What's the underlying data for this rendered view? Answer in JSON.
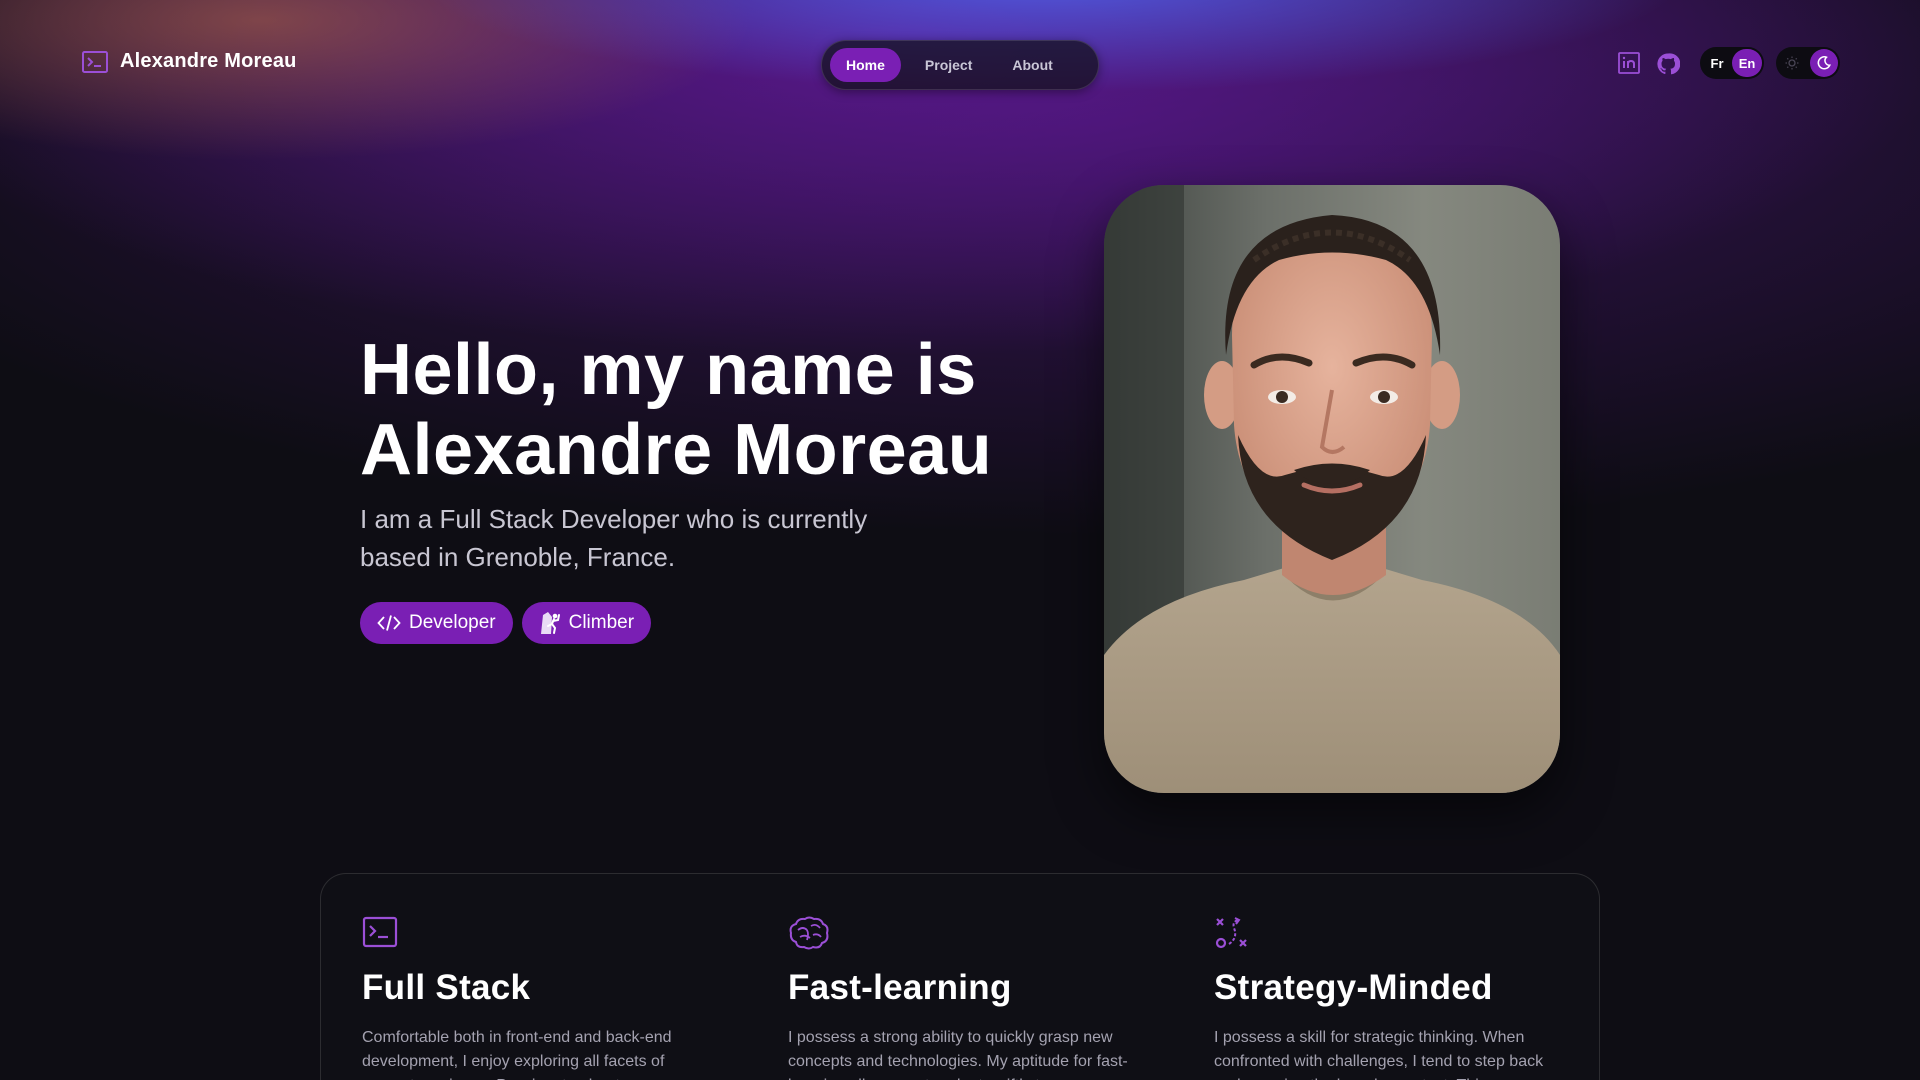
{
  "brand": {
    "name": "Alexandre Moreau",
    "icon": "terminal-icon"
  },
  "nav": {
    "items": [
      {
        "label": "Home",
        "active": true
      },
      {
        "label": "Project",
        "active": false
      },
      {
        "label": "About",
        "active": false
      }
    ]
  },
  "header": {
    "social": [
      {
        "icon": "linkedin-icon"
      },
      {
        "icon": "github-icon"
      }
    ],
    "lang": {
      "fr": "Fr",
      "en": "En",
      "selected": "En"
    },
    "theme": {
      "light_icon": "sun-icon",
      "dark_icon": "moon-icon",
      "selected": "dark"
    }
  },
  "hero": {
    "title_line1": "Hello, my name is",
    "title_line2": "Alexandre Moreau",
    "subtitle": "I am a Full Stack Developer who is currently based in Grenoble, France.",
    "tags": [
      {
        "label": "Developer",
        "icon": "code-icon"
      },
      {
        "label": "Climber",
        "icon": "climber-icon"
      }
    ]
  },
  "features": [
    {
      "icon": "terminal-icon",
      "title": "Full Stack",
      "text": "Comfortable both in front-end and back-end development, I enjoy exploring all facets of computer science. Passionate about"
    },
    {
      "icon": "brain-icon",
      "title": "Fast-learning",
      "text": "I possess a strong ability to quickly grasp new concepts and technologies. My aptitude for fast-learning allows me to adapt swiftly to"
    },
    {
      "icon": "strategy-icon",
      "title": "Strategy-Minded",
      "text": "I possess a skill for strategic thinking. When confronted with challenges, I tend to step back and examine the broader context. This"
    }
  ],
  "colors": {
    "accent": "#7a1fb4",
    "icon_accent": "#9b4fd6",
    "background": "#0e0d14"
  }
}
